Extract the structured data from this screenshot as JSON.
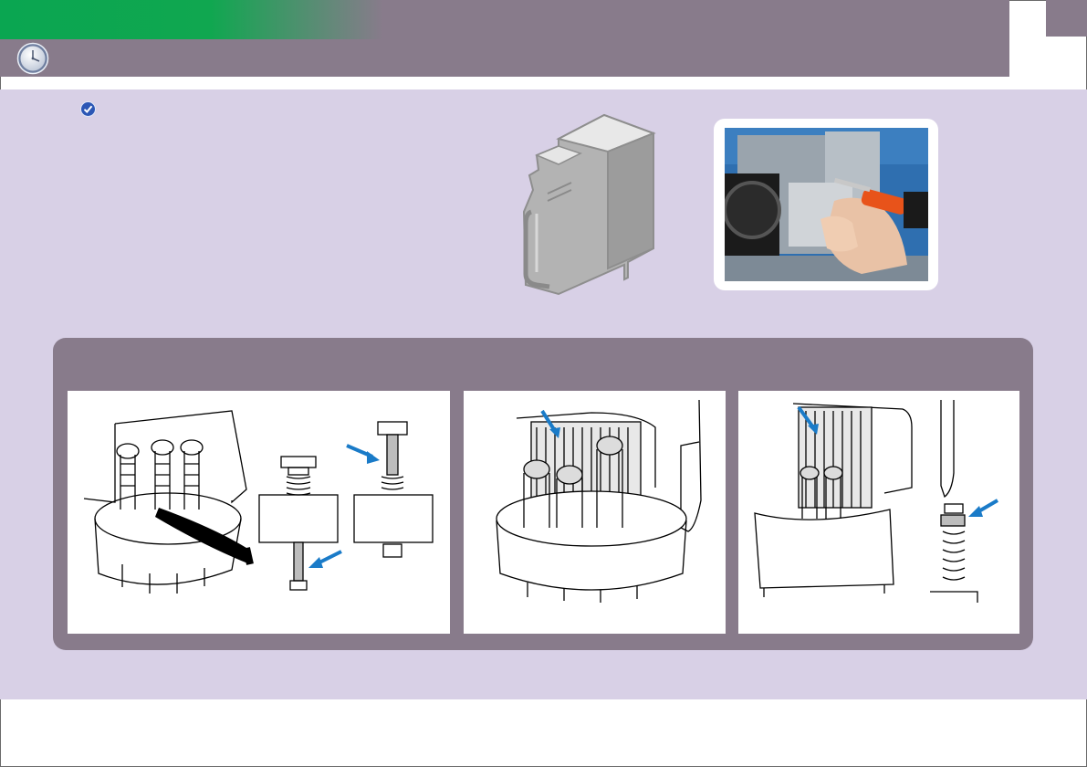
{
  "page": {
    "colors": {
      "header": "#887b8b",
      "accent_green": "#0aa651",
      "content_background": "#d8d0e6",
      "panel": "#887b8b",
      "arrow": "#1a7bc8"
    },
    "icons": [
      "clock-icon",
      "check-badge-icon",
      "arrow-icon"
    ]
  },
  "illustrations": {
    "part": "",
    "photo": "",
    "steps": [
      "",
      "",
      ""
    ]
  }
}
